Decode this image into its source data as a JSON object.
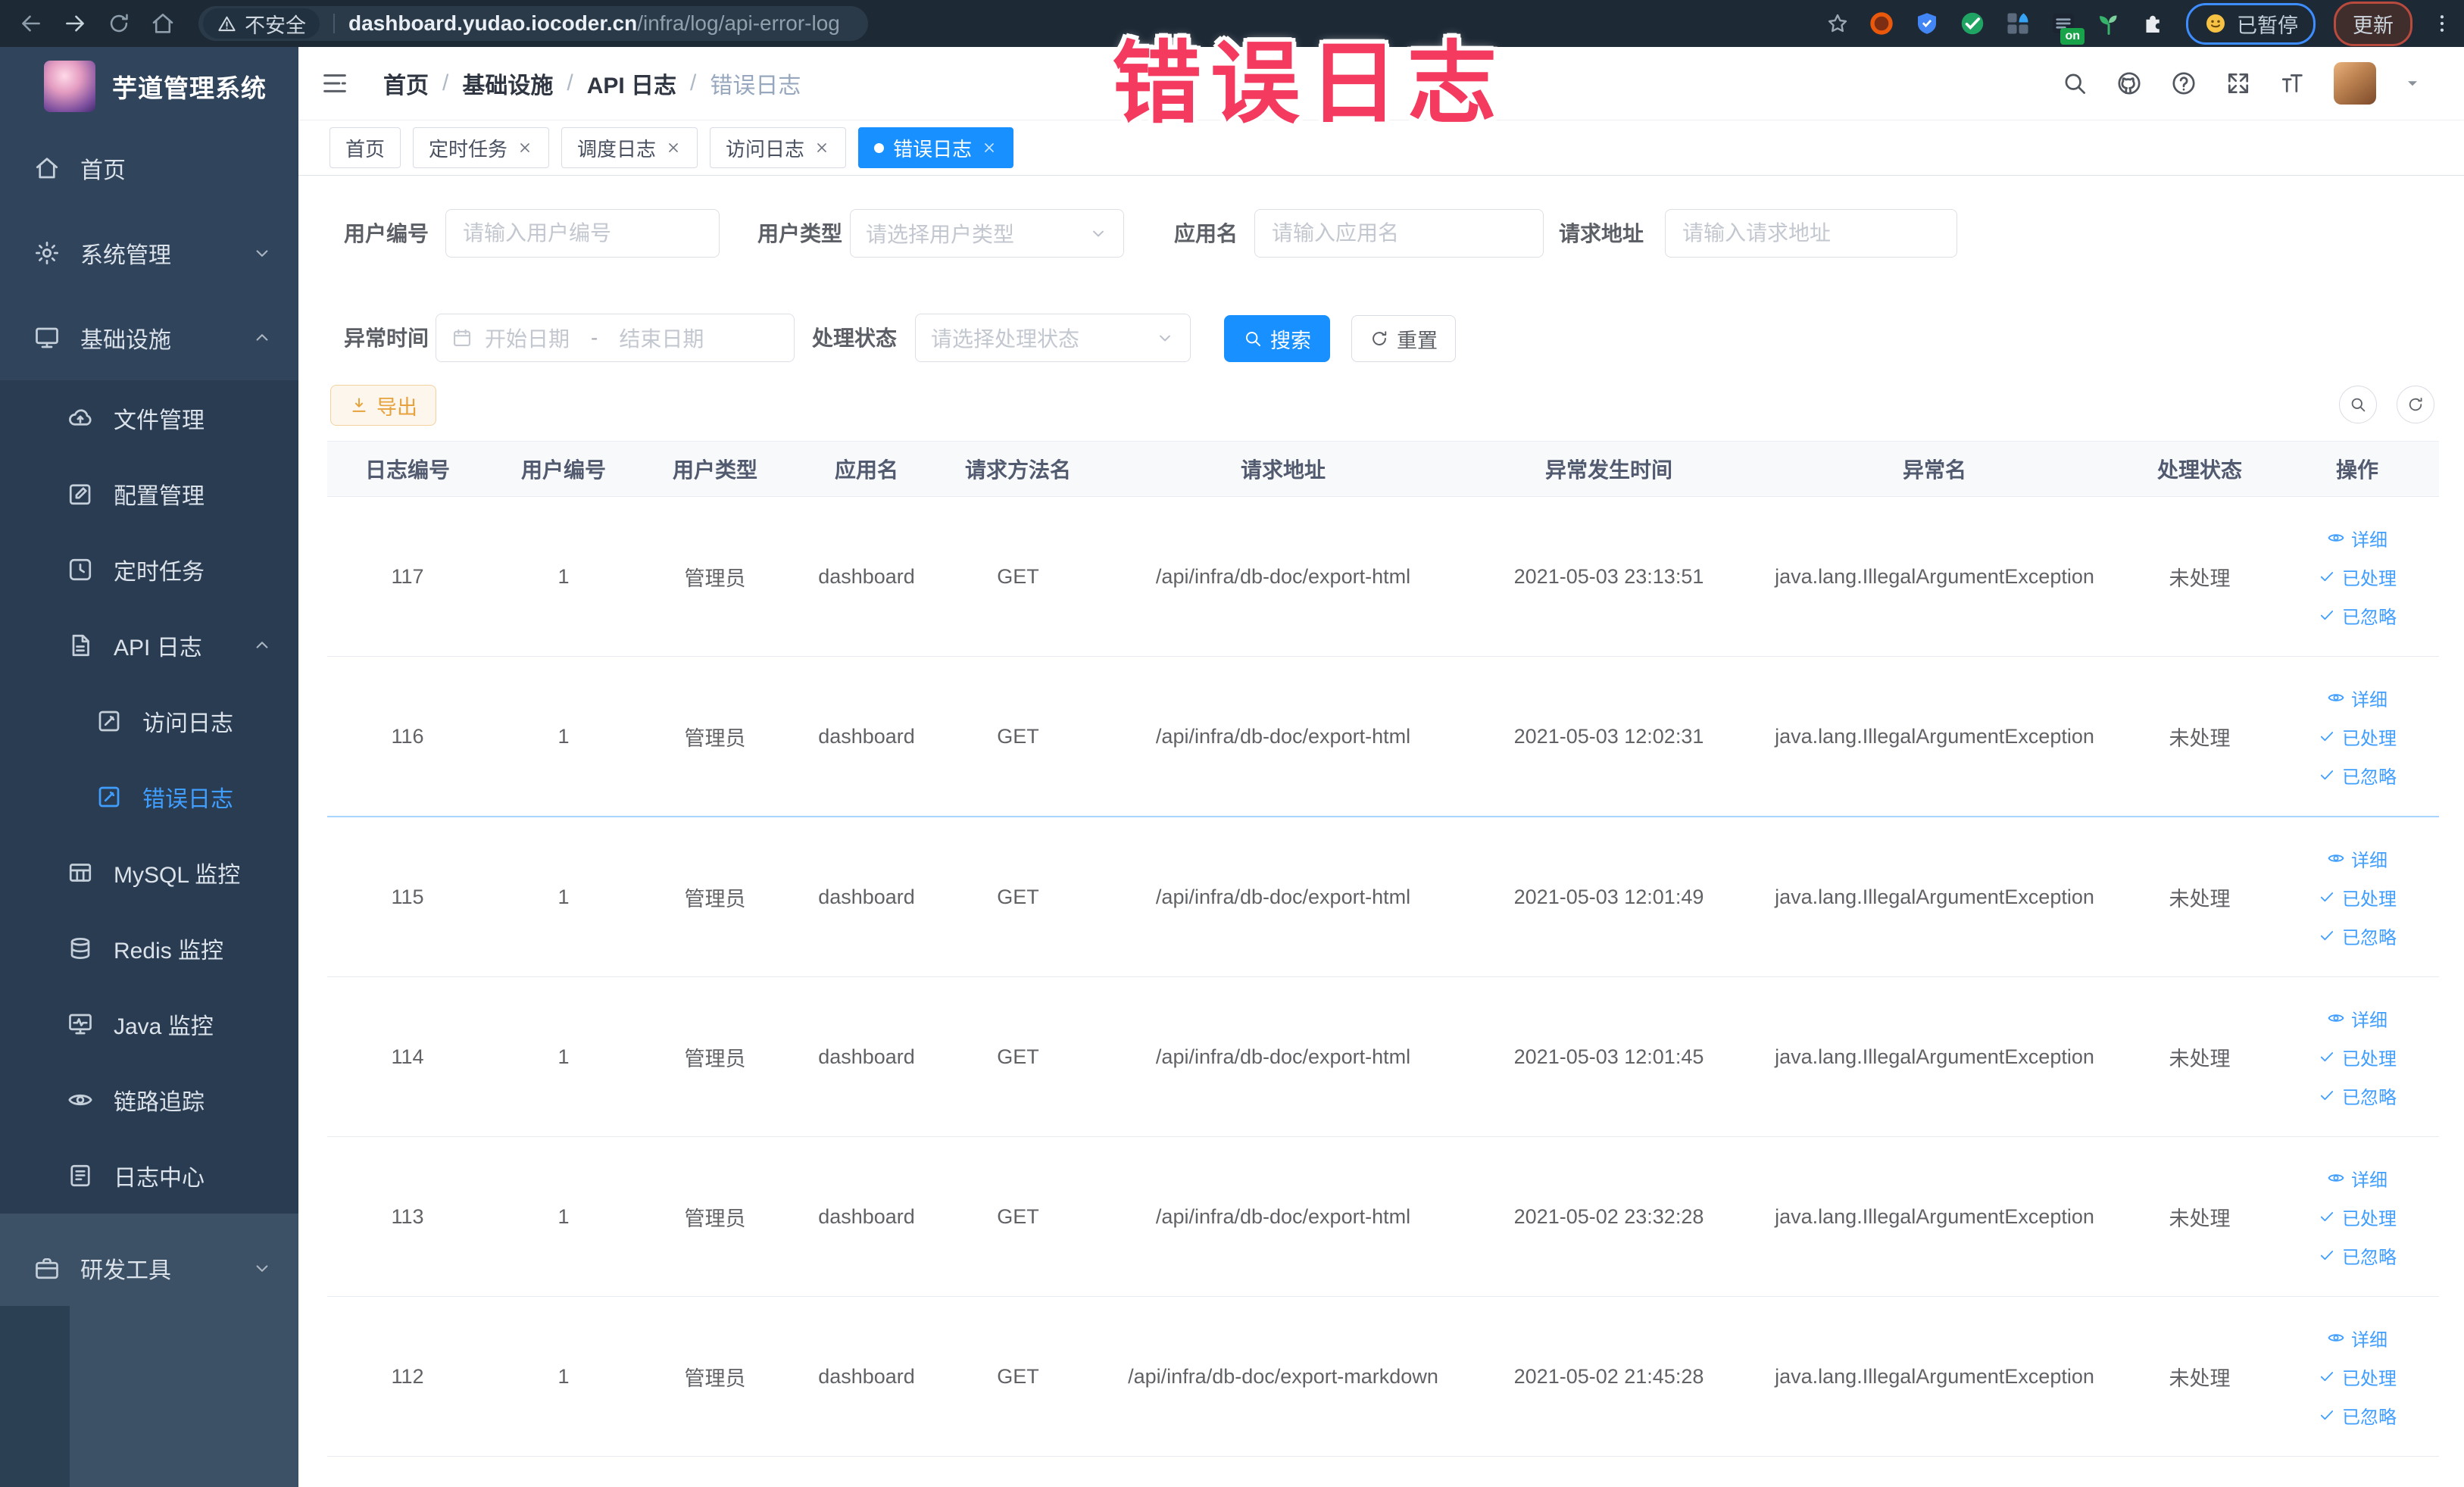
{
  "browser": {
    "security_label": "不安全",
    "url_host": "dashboard.yudao.iocoder.cn",
    "url_path": "/infra/log/api-error-log",
    "extension_badge": "on",
    "paused_badge": "已暂停",
    "update_button": "更新"
  },
  "overlay_text": "错误日志",
  "sidebar": {
    "title": "芋道管理系统",
    "items": [
      {
        "label": "首页",
        "icon": "home",
        "level": 1,
        "group": "top"
      },
      {
        "label": "系统管理",
        "icon": "gear",
        "level": 1,
        "group": "top",
        "chevron": "down"
      },
      {
        "label": "基础设施",
        "icon": "monitor",
        "level": 1,
        "group": "top",
        "chevron": "up"
      },
      {
        "label": "文件管理",
        "icon": "cloud",
        "level": 2,
        "group": "sub"
      },
      {
        "label": "配置管理",
        "icon": "edit",
        "level": 2,
        "group": "sub"
      },
      {
        "label": "定时任务",
        "icon": "clock",
        "level": 2,
        "group": "sub"
      },
      {
        "label": "API 日志",
        "icon": "api-log",
        "level": 2,
        "group": "sub",
        "chevron": "up"
      },
      {
        "label": "访问日志",
        "icon": "doc-edit",
        "level": 3,
        "group": "sub"
      },
      {
        "label": "错误日志",
        "icon": "doc-edit",
        "level": 3,
        "group": "sub",
        "active": true
      },
      {
        "label": "MySQL 监控",
        "icon": "mysql",
        "level": 2,
        "group": "sub"
      },
      {
        "label": "Redis 监控",
        "icon": "redis",
        "level": 2,
        "group": "sub"
      },
      {
        "label": "Java 监控",
        "icon": "java",
        "level": 2,
        "group": "sub"
      },
      {
        "label": "链路追踪",
        "icon": "trace",
        "level": 2,
        "group": "sub"
      },
      {
        "label": "日志中心",
        "icon": "log-center",
        "level": 2,
        "group": "sub"
      },
      {
        "label": "研发工具",
        "icon": "briefcase",
        "level": 1,
        "group": "bottom",
        "chevron": "down"
      }
    ]
  },
  "header": {
    "breadcrumb": [
      "首页",
      "基础设施",
      "API 日志",
      "错误日志"
    ],
    "breadcrumb_separator": "/",
    "tabs": [
      {
        "label": "首页",
        "closable": false,
        "active": false
      },
      {
        "label": "定时任务",
        "closable": true,
        "active": false
      },
      {
        "label": "调度日志",
        "closable": true,
        "active": false
      },
      {
        "label": "访问日志",
        "closable": true,
        "active": false
      },
      {
        "label": "错误日志",
        "closable": true,
        "active": true
      }
    ]
  },
  "filters": {
    "user_id_label": "用户编号",
    "user_id_placeholder": "请输入用户编号",
    "user_type_label": "用户类型",
    "user_type_placeholder": "请选择用户类型",
    "app_name_label": "应用名",
    "app_name_placeholder": "请输入应用名",
    "request_url_label": "请求地址",
    "request_url_placeholder": "请输入请求地址",
    "exception_time_label": "异常时间",
    "date_start_placeholder": "开始日期",
    "date_separator": "-",
    "date_end_placeholder": "结束日期",
    "process_status_label": "处理状态",
    "process_status_placeholder": "请选择处理状态",
    "search_button": "搜索",
    "reset_button": "重置"
  },
  "toolbar": {
    "export_button": "导出"
  },
  "table": {
    "columns": [
      "日志编号",
      "用户编号",
      "用户类型",
      "应用名",
      "请求方法名",
      "请求地址",
      "异常发生时间",
      "异常名",
      "处理状态",
      "操作"
    ],
    "action_labels": [
      "详细",
      "已处理",
      "已忽略"
    ],
    "rows": [
      {
        "log_id": "117",
        "user_id": "1",
        "user_type": "管理员",
        "app_name": "dashboard",
        "method": "GET",
        "request_url": "/api/infra/db-doc/export-html",
        "exception_time": "2021-05-03 23:13:51",
        "exception_name": "java.lang.IllegalArgumentException",
        "status": "未处理"
      },
      {
        "log_id": "116",
        "user_id": "1",
        "user_type": "管理员",
        "app_name": "dashboard",
        "method": "GET",
        "request_url": "/api/infra/db-doc/export-html",
        "exception_time": "2021-05-03 12:02:31",
        "exception_name": "java.lang.IllegalArgumentException",
        "status": "未处理"
      },
      {
        "log_id": "115",
        "user_id": "1",
        "user_type": "管理员",
        "app_name": "dashboard",
        "method": "GET",
        "request_url": "/api/infra/db-doc/export-html",
        "exception_time": "2021-05-03 12:01:49",
        "exception_name": "java.lang.IllegalArgumentException",
        "status": "未处理"
      },
      {
        "log_id": "114",
        "user_id": "1",
        "user_type": "管理员",
        "app_name": "dashboard",
        "method": "GET",
        "request_url": "/api/infra/db-doc/export-html",
        "exception_time": "2021-05-03 12:01:45",
        "exception_name": "java.lang.IllegalArgumentException",
        "status": "未处理"
      },
      {
        "log_id": "113",
        "user_id": "1",
        "user_type": "管理员",
        "app_name": "dashboard",
        "method": "GET",
        "request_url": "/api/infra/db-doc/export-html",
        "exception_time": "2021-05-02 23:32:28",
        "exception_name": "java.lang.IllegalArgumentException",
        "status": "未处理"
      },
      {
        "log_id": "112",
        "user_id": "1",
        "user_type": "管理员",
        "app_name": "dashboard",
        "method": "GET",
        "request_url": "/api/infra/db-doc/export-markdown",
        "exception_time": "2021-05-02 21:45:28",
        "exception_name": "java.lang.IllegalArgumentException",
        "status": "未处理"
      }
    ]
  },
  "colors": {
    "primary": "#409eff",
    "active_tab": "#1890ff",
    "warning": "#e6a23c",
    "overlay_pink": "#f43b5f",
    "sidebar_bg": "#30445c",
    "submenu_bg": "#2a3c52",
    "chrome_bg": "#1d2935"
  }
}
